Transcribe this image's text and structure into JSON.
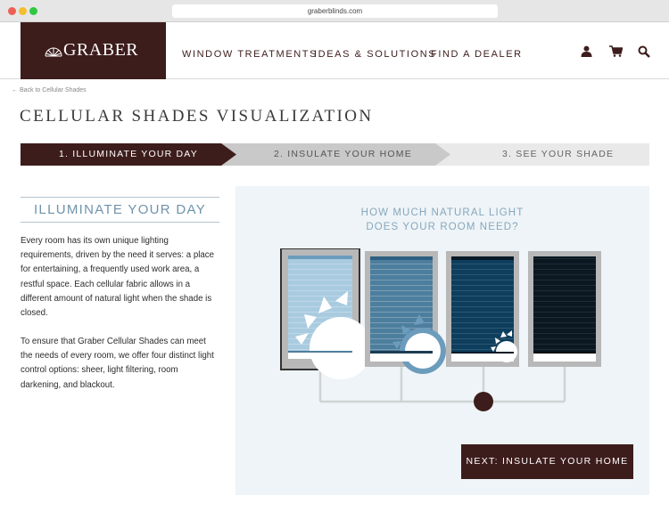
{
  "browser": {
    "url": "graberblinds.com"
  },
  "header": {
    "logo": "GRABER",
    "nav": [
      "WINDOW TREATMENTS",
      "IDEAS & SOLUTIONS",
      "FIND A DEALER"
    ]
  },
  "breadcrumb": "← Back to Cellular Shades",
  "page_title": "CELLULAR SHADES VISUALIZATION",
  "steps": [
    "1. ILLUMINATE YOUR DAY",
    "2. INSULATE YOUR HOME",
    "3. SEE YOUR SHADE"
  ],
  "section": {
    "heading": "ILLUMINATE YOUR DAY",
    "paragraph1": "Every room has its own unique lighting requirements, driven by the need it serves: a place for entertaining, a frequently used work area, a restful space. Each cellular fabric allows in a different amount of natural light when the shade is closed.",
    "paragraph2": "To ensure that Graber Cellular Shades can meet the needs of every room, we offer four distinct light control options: sheer, light filtering, room darkening, and blackout."
  },
  "visualizer": {
    "question_line1": "HOW MUCH NATURAL LIGHT",
    "question_line2": "DOES YOUR ROOM NEED?",
    "options": [
      {
        "name": "sheer",
        "color": "#a9cbe0"
      },
      {
        "name": "light-filtering",
        "color": "#4d7e9e"
      },
      {
        "name": "room-darkening",
        "color": "#0e3e5d"
      },
      {
        "name": "blackout",
        "color": "#0b1821"
      }
    ],
    "selected_index": 2
  },
  "next_button": "NEXT: INSULATE YOUR HOME",
  "colors": {
    "brand": "#3d1d1c",
    "accent": "#6f93ab"
  }
}
